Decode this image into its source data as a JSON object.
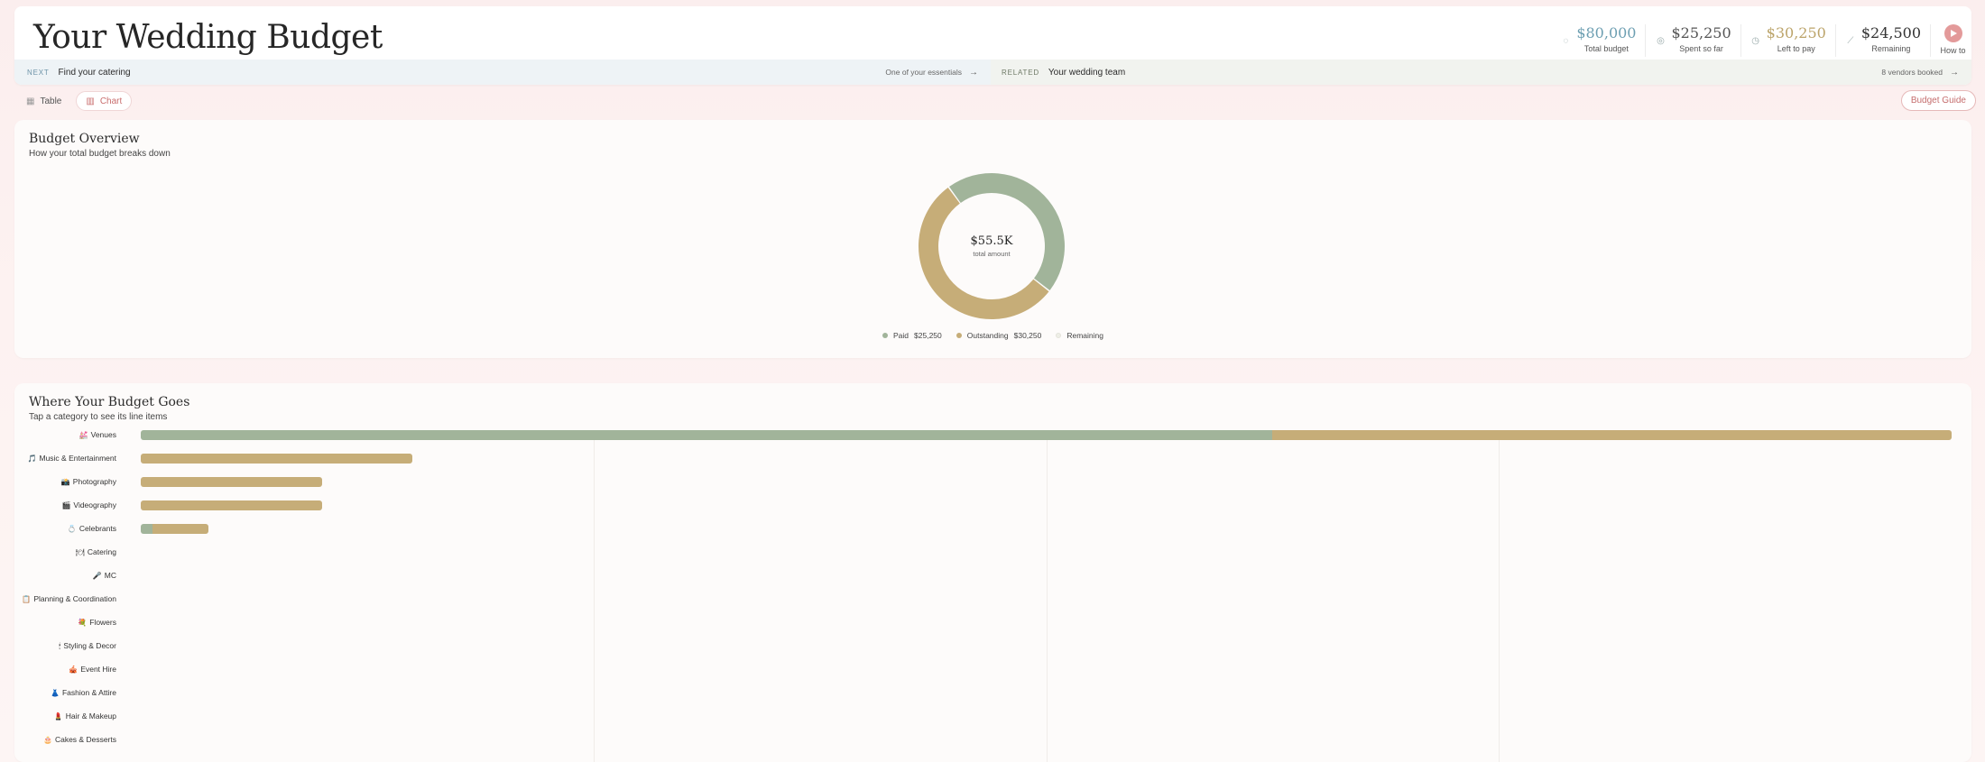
{
  "header": {
    "title": "Your Wedding Budget",
    "stats": [
      {
        "value": "$80,000",
        "label": "Total budget",
        "icon": "tag-icon",
        "color": "#6d9fb2"
      },
      {
        "value": "$25,250",
        "label": "Spent so far",
        "icon": "check-circle-icon",
        "color": "#555555"
      },
      {
        "value": "$30,250",
        "label": "Left to pay",
        "icon": "clock-icon",
        "color": "#bca46a"
      },
      {
        "value": "$24,500",
        "label": "Remaining",
        "icon": "trend-icon",
        "color": "#333333"
      }
    ],
    "howto_label": "How to"
  },
  "next_bar": {
    "next_tag": "NEXT",
    "next_text": "Find your catering",
    "next_side": "One of your essentials",
    "related_tag": "RELATED",
    "related_text": "Your wedding team",
    "related_side": "8 vendors booked"
  },
  "toolbar": {
    "table_label": "Table",
    "chart_label": "Chart",
    "active_view": "Chart",
    "guide_label": "Budget Guide"
  },
  "overview": {
    "title": "Budget Overview",
    "subtitle": "How your total budget breaks down",
    "center_value": "$55.5K",
    "center_label": "total amount",
    "legend": [
      {
        "label": "Paid",
        "value": "$25,250",
        "color": "#a1b49a"
      },
      {
        "label": "Outstanding",
        "value": "$30,250",
        "color": "#c6ad78"
      },
      {
        "label": "Remaining",
        "value": "",
        "color": "#eeeee6"
      }
    ]
  },
  "breakdown": {
    "title": "Where Your Budget Goes",
    "subtitle": "Tap a category to see its line items"
  },
  "chart_data": [
    {
      "type": "pie",
      "categories": [
        "Paid",
        "Outstanding"
      ],
      "values": [
        25250,
        30250
      ],
      "colors": [
        "#a1b49a",
        "#c6ad78"
      ]
    },
    {
      "type": "bar",
      "orientation": "horizontal",
      "stacked": true,
      "categories": [
        "Venues",
        "Music & Entertainment",
        "Photography",
        "Videography",
        "Celebrants",
        "Catering",
        "MC",
        "Planning & Coordination",
        "Flowers",
        "Styling & Decor",
        "Event Hire",
        "Fashion & Attire",
        "Hair & Makeup",
        "Cakes & Desserts"
      ],
      "icons": [
        "💒",
        "🎵",
        "📸",
        "🎬",
        "💍",
        "🍽",
        "🎤",
        "📋",
        "💐",
        "🕯",
        "🎪",
        "👗",
        "💄",
        "🎂"
      ],
      "series": [
        {
          "name": "Paid",
          "values": [
            25000,
            0,
            0,
            0,
            250,
            0,
            0,
            0,
            0,
            0,
            0,
            0,
            0,
            0
          ],
          "color": "#a1b49a"
        },
        {
          "name": "Outstanding",
          "values": [
            15000,
            6000,
            4000,
            4000,
            1250,
            0,
            0,
            0,
            0,
            0,
            0,
            0,
            0,
            0
          ],
          "color": "#c6ad78"
        }
      ],
      "xlim": [
        0,
        40000
      ],
      "grid": true
    }
  ]
}
